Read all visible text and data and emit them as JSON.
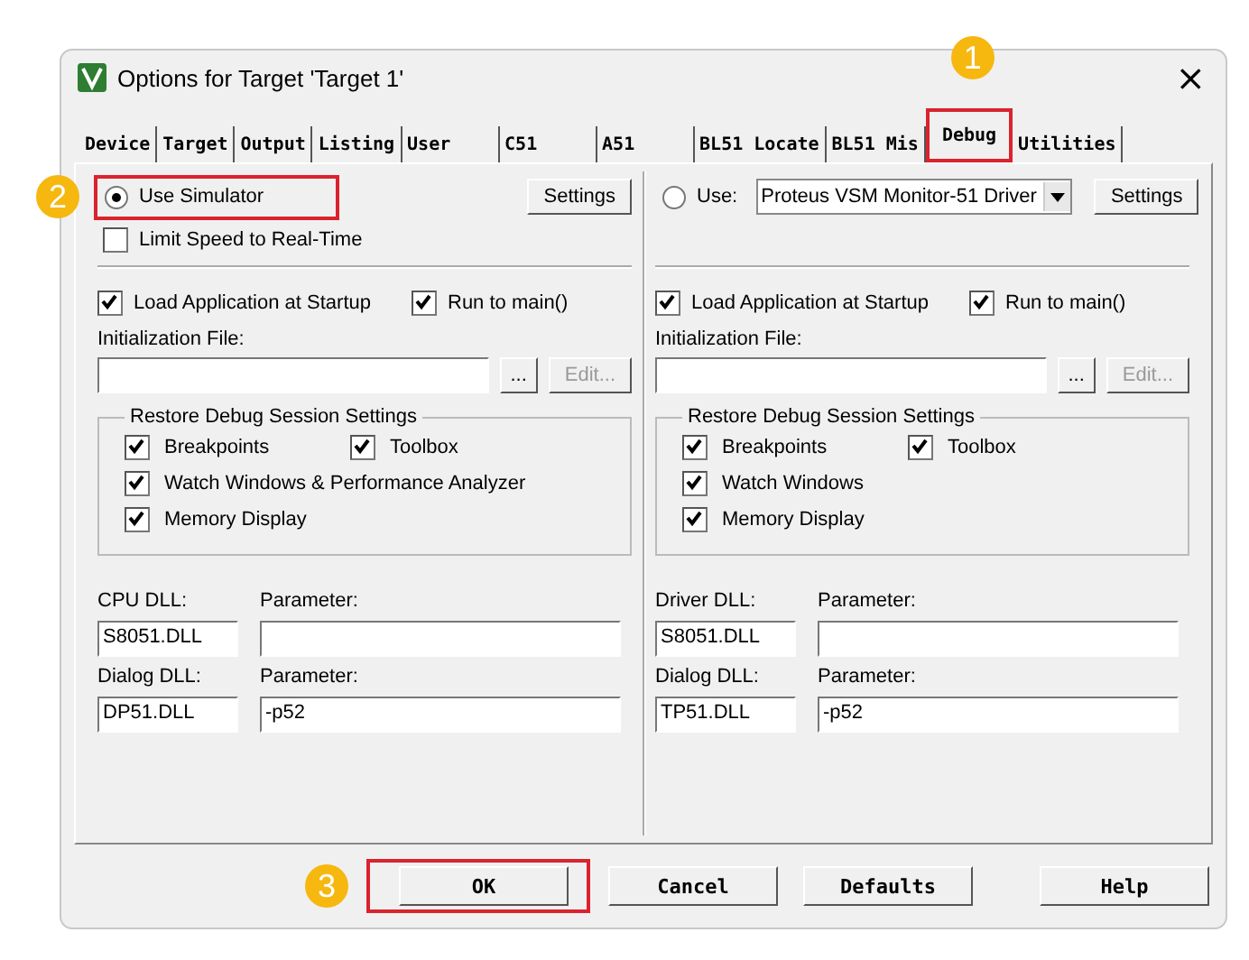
{
  "window": {
    "title": "Options for Target 'Target 1'",
    "close": "×"
  },
  "tabs": [
    {
      "label": "Device",
      "selected": false,
      "highlighted": false
    },
    {
      "label": "Target",
      "selected": false,
      "highlighted": false
    },
    {
      "label": "Output",
      "selected": false,
      "highlighted": false
    },
    {
      "label": "Listing",
      "selected": false,
      "highlighted": false
    },
    {
      "label": "User",
      "selected": false,
      "highlighted": false
    },
    {
      "label": "C51",
      "selected": false,
      "highlighted": false
    },
    {
      "label": "A51",
      "selected": false,
      "highlighted": false
    },
    {
      "label": "BL51 Locate",
      "selected": false,
      "highlighted": false
    },
    {
      "label": "BL51 Mis",
      "selected": false,
      "highlighted": false
    },
    {
      "label": "Debug",
      "selected": true,
      "highlighted": true,
      "callout": "1"
    },
    {
      "label": "Utilities",
      "selected": false,
      "highlighted": false
    }
  ],
  "panels": [
    {
      "mode": {
        "label": "Use Simulator",
        "selected": true,
        "highlighted": true,
        "callout": "2"
      },
      "settings": "Settings",
      "limit_speed": {
        "label": "Limit Speed to Real-Time",
        "checked": false
      },
      "load_app": {
        "label": "Load Application at Startup",
        "checked": true
      },
      "run_to_main": {
        "label": "Run to main()",
        "checked": true
      },
      "init_label": "Initialization File:",
      "browse": "...",
      "edit": {
        "label": "Edit...",
        "disabled": true
      },
      "restore": {
        "title": "Restore Debug Session Settings",
        "items": [
          {
            "label": "Breakpoints",
            "checked": true
          },
          {
            "label": "Toolbox",
            "checked": true
          },
          {
            "label": "Watch Windows & Performance Analyzer",
            "checked": true
          },
          {
            "label": "Memory Display",
            "checked": true
          }
        ]
      },
      "dll_label": "CPU DLL:",
      "dll_param_label": "Parameter:",
      "dll": "S8051.DLL",
      "dialog_label": "Dialog DLL:",
      "dialog_param_label": "Parameter:",
      "dialog": "DP51.DLL",
      "dialog_param": "-p52"
    },
    {
      "mode": {
        "label": "Use:",
        "selected": false,
        "highlighted": false
      },
      "driver": "Proteus VSM Monitor-51 Driver",
      "settings": "Settings",
      "load_app": {
        "label": "Load Application at Startup",
        "checked": true
      },
      "run_to_main": {
        "label": "Run to main()",
        "checked": true
      },
      "init_label": "Initialization File:",
      "browse": "...",
      "edit": {
        "label": "Edit...",
        "disabled": true
      },
      "restore": {
        "title": "Restore Debug Session Settings",
        "items": [
          {
            "label": "Breakpoints",
            "checked": true
          },
          {
            "label": "Toolbox",
            "checked": true
          },
          {
            "label": "Watch Windows",
            "checked": true
          },
          {
            "label": "Memory Display",
            "checked": true
          }
        ]
      },
      "dll_label": "Driver DLL:",
      "dll_param_label": "Parameter:",
      "dll": "S8051.DLL",
      "dialog_label": "Dialog DLL:",
      "dialog_param_label": "Parameter:",
      "dialog": "TP51.DLL",
      "dialog_param": "-p52"
    }
  ],
  "buttons": [
    {
      "label": "OK",
      "highlighted": true,
      "callout": "3"
    },
    {
      "label": "Cancel",
      "highlighted": false
    },
    {
      "label": "Defaults",
      "highlighted": false
    },
    {
      "label": "Help",
      "highlighted": false
    }
  ]
}
